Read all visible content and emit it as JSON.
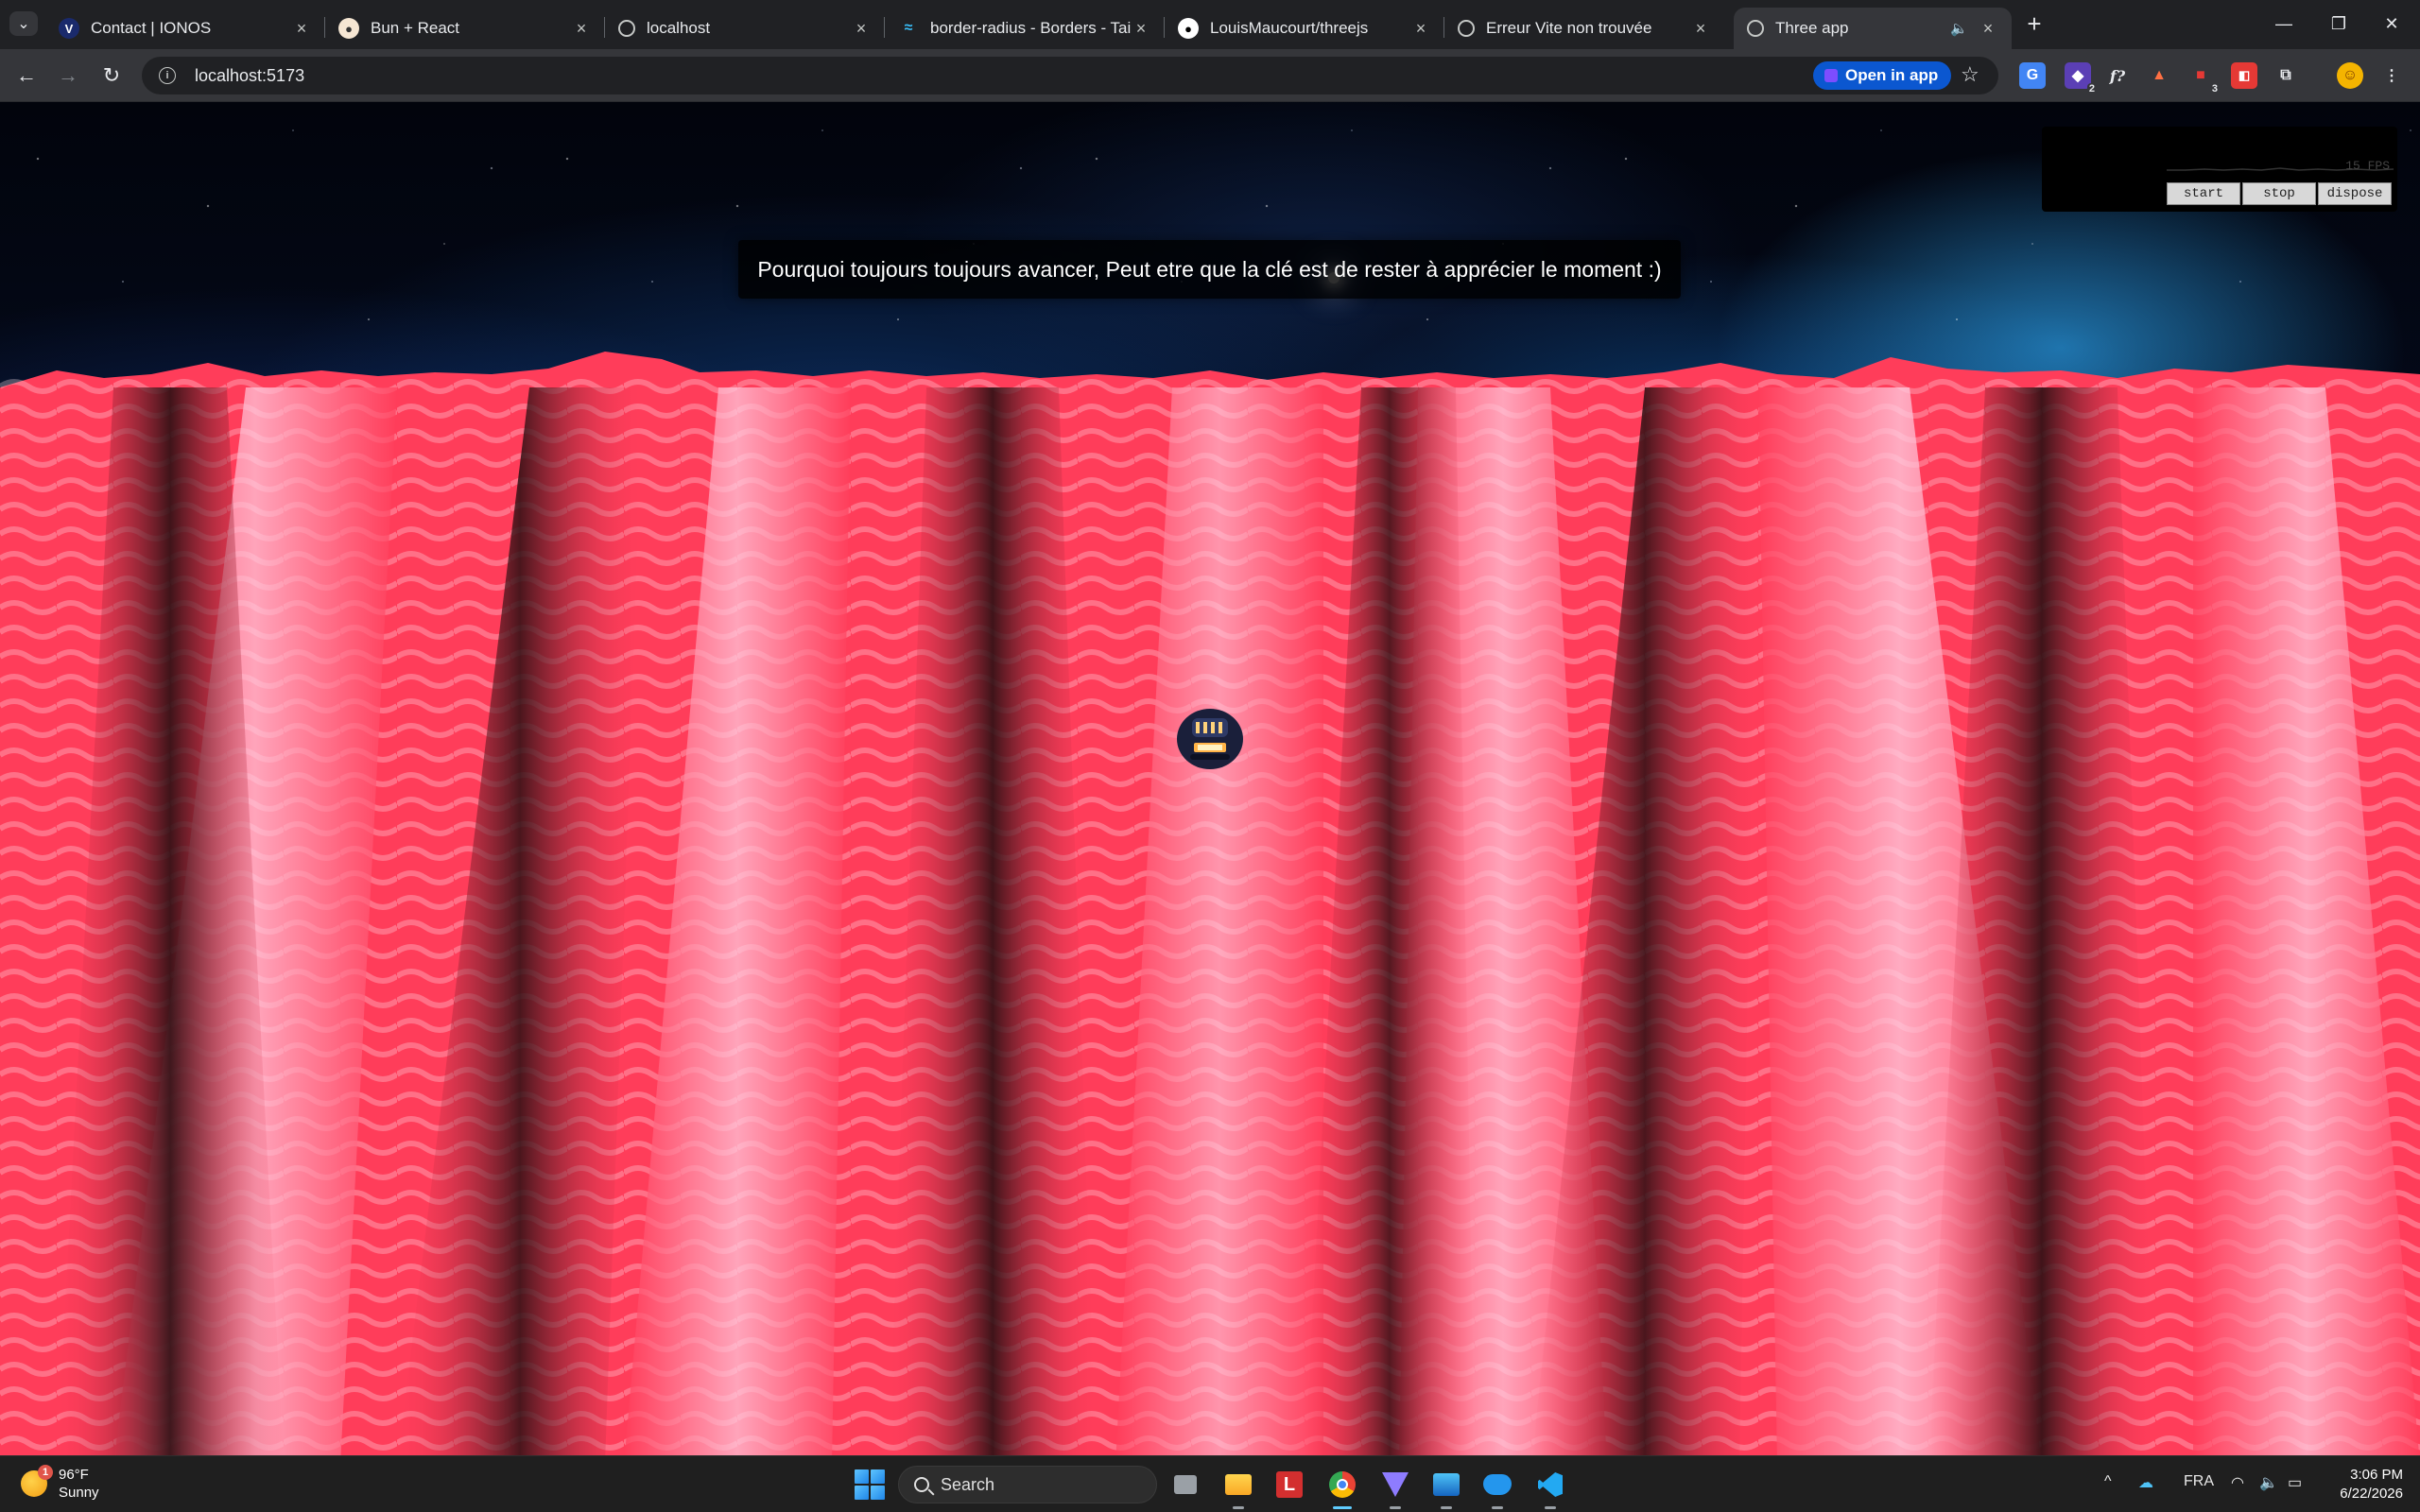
{
  "browser": {
    "tabs": [
      {
        "title": "Contact | IONOS",
        "favicon": "ionos-icon"
      },
      {
        "title": "Bun + React",
        "favicon": "bun-icon"
      },
      {
        "title": "localhost",
        "favicon": "globe-icon"
      },
      {
        "title": "border-radius - Borders - Tailwi",
        "favicon": "tailwind-icon"
      },
      {
        "title": "LouisMaucourt/threejs",
        "favicon": "github-icon"
      },
      {
        "title": "Erreur Vite non trouvée",
        "favicon": "vite-icon"
      },
      {
        "title": "Three app",
        "favicon": "globe-icon",
        "active": true
      }
    ],
    "url": "localhost:5173",
    "open_in_app": "Open in app",
    "extension_badges": {
      "second": "2",
      "sixth": "3"
    }
  },
  "scene": {
    "message": "Pourquoi toujours toujours avancer, Peut etre que la clé est de rester à apprécier le moment :)",
    "ground_color": "#ff3d5a",
    "sky_color": "#0b2a5a"
  },
  "stats": {
    "fps_label": "15 FPS",
    "buttons": {
      "start": "start",
      "stop": "stop",
      "dispose": "dispose"
    }
  },
  "taskbar": {
    "weather_temp": "96°F",
    "weather_cond": "Sunny",
    "weather_alert": "1",
    "search_placeholder": "Search",
    "language": "FRA",
    "time": "3:06 PM",
    "date": "6/22/2026"
  }
}
